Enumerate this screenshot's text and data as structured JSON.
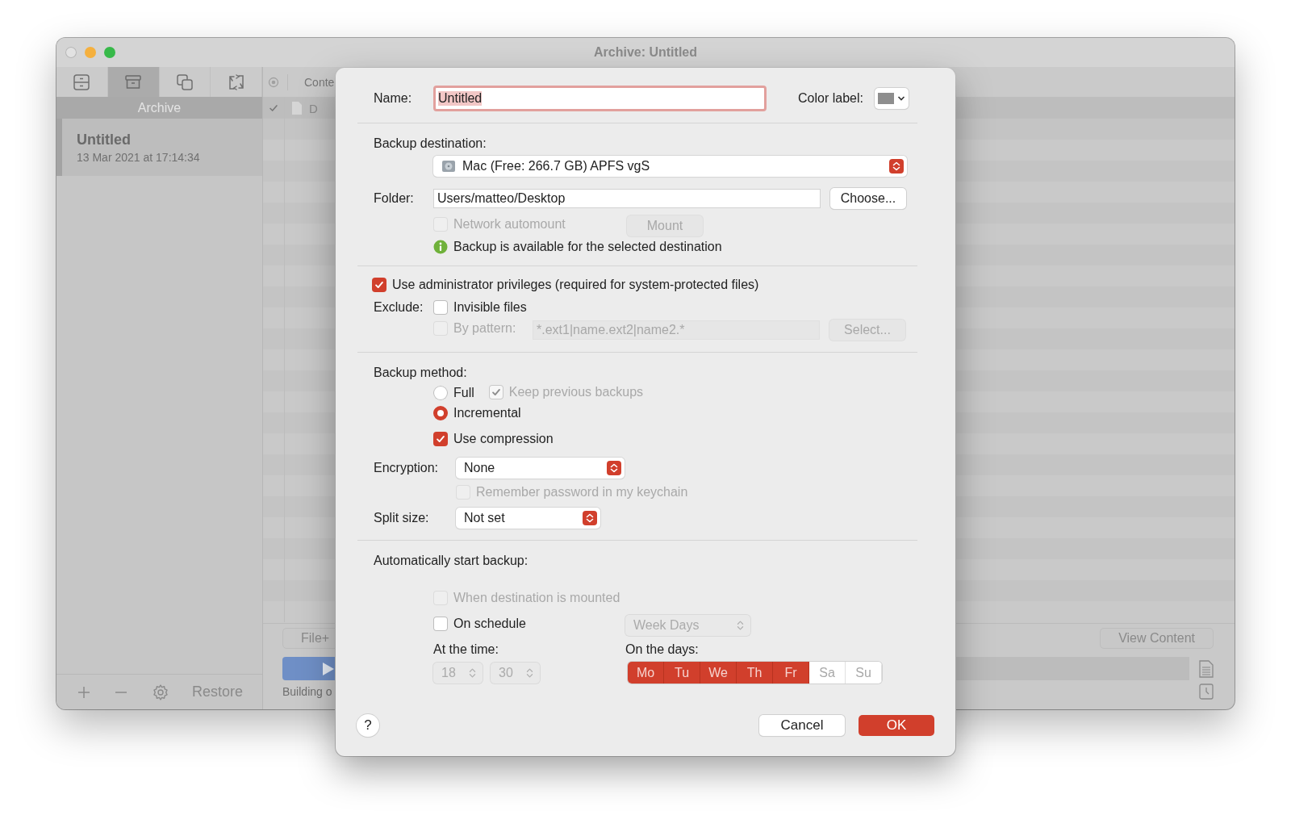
{
  "window": {
    "title": "Archive: Untitled"
  },
  "sidebar": {
    "tabs": [
      {
        "kind": "cabinet",
        "selected": false
      },
      {
        "kind": "archive",
        "selected": true
      },
      {
        "kind": "copies",
        "selected": false
      },
      {
        "kind": "sync",
        "selected": false
      }
    ],
    "header": "Archive",
    "items": [
      {
        "title": "Untitled",
        "subtitle": "13 Mar 2021 at 17:14:34",
        "selected": true
      }
    ],
    "footer": {
      "restore": "Restore"
    }
  },
  "content": {
    "column_header": "Conte",
    "rows": [
      {
        "checked": true,
        "name": "D"
      }
    ],
    "file_button": "File+",
    "status": "Building o",
    "view_button": "View Content",
    "progress": {
      "level": 0
    }
  },
  "dialog": {
    "name": {
      "label": "Name:",
      "value": "Untitled"
    },
    "color_label": {
      "label": "Color label:",
      "color": "#8e8e8e"
    },
    "destination": {
      "label": "Backup destination:",
      "value": "Mac (Free: 266.7 GB) APFS vgS"
    },
    "folder": {
      "label": "Folder:",
      "value": "Users/matteo/Desktop",
      "button": "Choose..."
    },
    "network_automount": {
      "label": "Network automount",
      "checked": false,
      "disabled": true
    },
    "mount_button": {
      "label": "Mount",
      "disabled": true
    },
    "info": "Backup is available for the selected destination",
    "admin": {
      "label": "Use administrator privileges (required for system-protected files)",
      "checked": true
    },
    "exclude": {
      "label": "Exclude:",
      "invisible": {
        "label": "Invisible files",
        "checked": false
      },
      "pattern": {
        "label": "By pattern:",
        "checked": false,
        "placeholder": "*.ext1|name.ext2|name2.*",
        "button": "Select...",
        "disabled": true
      }
    },
    "method": {
      "label": "Backup method:",
      "options": [
        {
          "label": "Full",
          "selected": false
        },
        {
          "label": "Incremental",
          "selected": true
        }
      ],
      "keep_previous": {
        "label": "Keep previous backups",
        "checked": true,
        "disabled": true
      }
    },
    "compression": {
      "label": "Use compression",
      "checked": true
    },
    "encryption": {
      "label": "Encryption:",
      "value": "None"
    },
    "remember_password": {
      "label": "Remember password in my keychain",
      "checked": false,
      "disabled": true
    },
    "split_size": {
      "label": "Split size:",
      "value": "Not set"
    },
    "auto": {
      "label": "Automatically start backup:",
      "when_mounted": {
        "label": "When destination is mounted",
        "checked": false,
        "disabled": true
      },
      "on_schedule": {
        "label": "On schedule",
        "checked": false
      },
      "schedule": {
        "value": "Week Days",
        "disabled": true
      },
      "time_label": "At the time:",
      "time": {
        "hour": "18",
        "minute": "30",
        "disabled": true
      },
      "days_label": "On the days:",
      "days": [
        {
          "label": "Mo",
          "selected": true
        },
        {
          "label": "Tu",
          "selected": true
        },
        {
          "label": "We",
          "selected": true
        },
        {
          "label": "Th",
          "selected": true
        },
        {
          "label": "Fr",
          "selected": true
        },
        {
          "label": "Sa",
          "selected": false
        },
        {
          "label": "Su",
          "selected": false
        }
      ]
    },
    "help": "?",
    "cancel": "Cancel",
    "ok": "OK"
  }
}
